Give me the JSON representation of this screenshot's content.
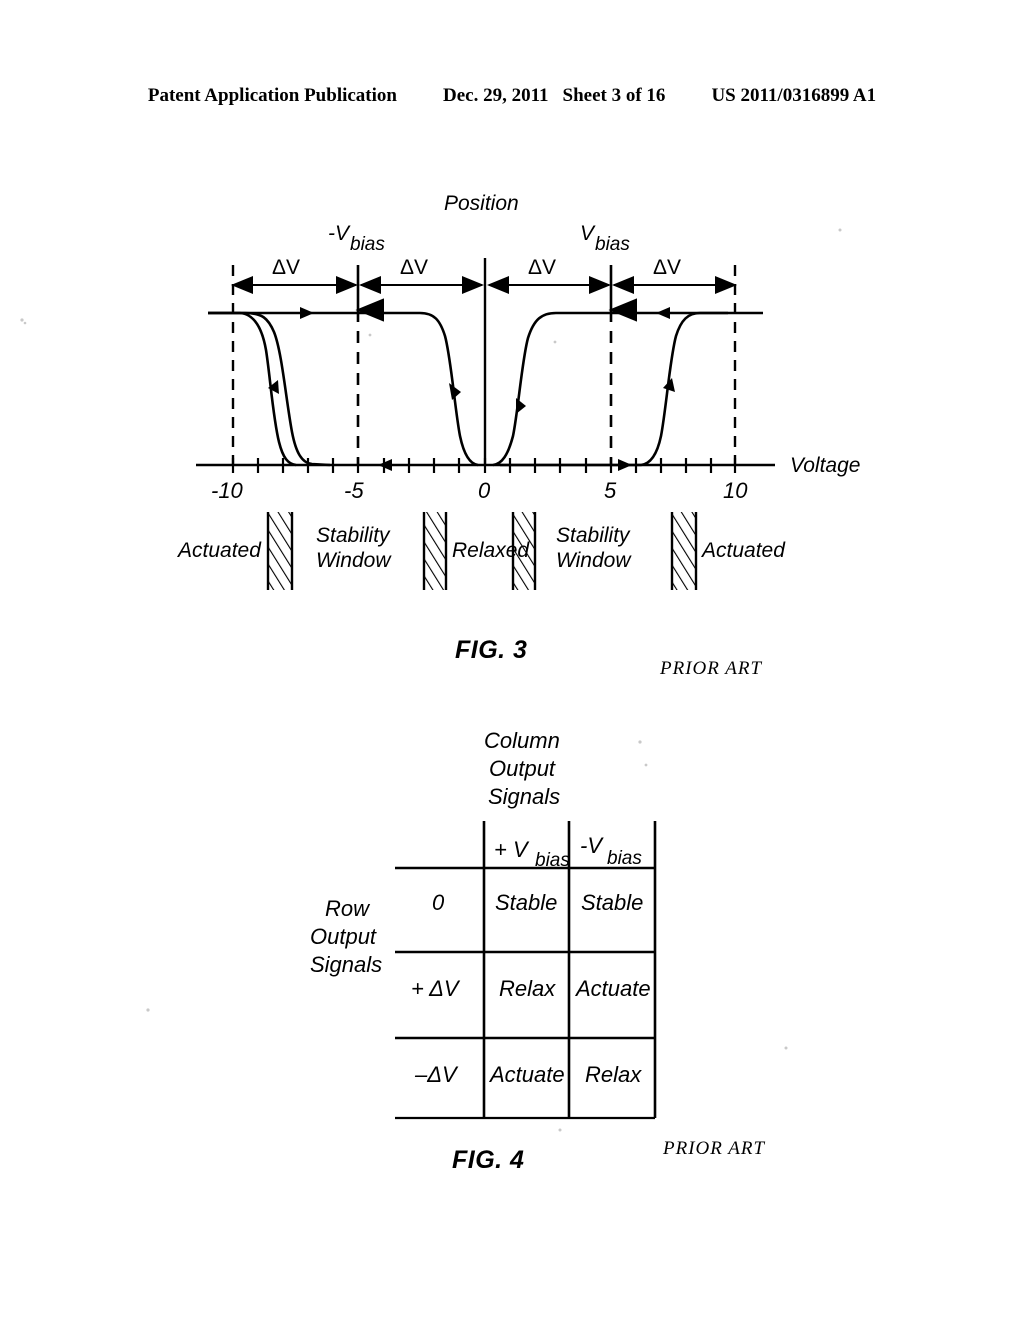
{
  "header": {
    "publication": "Patent Application Publication",
    "date": "Dec. 29, 2011",
    "sheet": "Sheet 3 of 16",
    "patent_number": "US 2011/0316899 A1"
  },
  "figure3": {
    "caption": "FIG. 3",
    "prior_art": "PRIOR ART",
    "y_axis_label": "Position",
    "x_axis_label": "Voltage",
    "bias_left_label": "-V",
    "bias_left_sub": "bias",
    "bias_right_label": "V",
    "bias_right_sub": "bias",
    "delta_labels": [
      "ΔV",
      "ΔV",
      "ΔV",
      "ΔV"
    ],
    "tick_labels": [
      "-10",
      "-5",
      "0",
      "5",
      "10"
    ],
    "region_labels": [
      "Actuated",
      "Stability Window",
      "Relaxed",
      "Stability Window",
      "Actuated"
    ],
    "region_label_lines": [
      [
        "Actuated"
      ],
      [
        "Stability",
        "Window"
      ],
      [
        "Relaxed"
      ],
      [
        "Stability",
        "Window"
      ],
      [
        "Actuated"
      ]
    ]
  },
  "chart_data": {
    "type": "line",
    "title": "",
    "xlabel": "Voltage",
    "ylabel": "Position",
    "xlim": [
      -11.5,
      11.5
    ],
    "ylim": [
      0,
      1
    ],
    "xticks": [
      -10,
      -9,
      -8,
      -7,
      -6,
      -5,
      -4,
      -3,
      -2,
      -1,
      0,
      1,
      2,
      3,
      4,
      5,
      6,
      7,
      8,
      9,
      10
    ],
    "xtick_labels": {
      "-10": "-10",
      "-5": "-5",
      "0": "0",
      "5": "5",
      "10": "10"
    },
    "grid": false,
    "legend": "none",
    "annotations": [
      {
        "text": "-Vbias",
        "x": -5,
        "type": "bias-marker"
      },
      {
        "text": "Vbias",
        "x": 5,
        "type": "bias-marker"
      },
      {
        "text": "ΔV",
        "from": -10,
        "to": -5,
        "type": "span-arrow"
      },
      {
        "text": "ΔV",
        "from": -5,
        "to": 0,
        "type": "span-arrow"
      },
      {
        "text": "ΔV",
        "from": 0,
        "to": 5,
        "type": "span-arrow"
      },
      {
        "text": "ΔV",
        "from": 5,
        "to": 10,
        "type": "span-arrow"
      }
    ],
    "dashed_verticals": [
      -10,
      -5,
      5,
      10
    ],
    "series": [
      {
        "name": "left-upper-branch",
        "comment": "actuated plateau from -10 to about -3 then falls to relaxed near -1",
        "direction": "rightward",
        "points": [
          [
            -11.3,
            1.0
          ],
          [
            -8.0,
            1.0
          ],
          [
            -4.0,
            1.0
          ],
          [
            -2.5,
            0.95
          ],
          [
            -2.0,
            0.6
          ],
          [
            -1.5,
            0.15
          ],
          [
            -1.0,
            0.0
          ],
          [
            -0.3,
            0.0
          ]
        ]
      },
      {
        "name": "left-lower-branch",
        "comment": "relaxed at -7 rising to actuated near -9",
        "direction": "leftward",
        "points": [
          [
            -0.3,
            0.0
          ],
          [
            -7.0,
            0.0
          ],
          [
            -7.6,
            0.12
          ],
          [
            -8.2,
            0.6
          ],
          [
            -8.8,
            0.95
          ],
          [
            -9.5,
            1.0
          ],
          [
            -11.3,
            1.0
          ]
        ]
      },
      {
        "name": "right-lower-branch",
        "comment": "relaxed near 1 rising to actuated plateau near 3",
        "direction": "rightward",
        "points": [
          [
            0.3,
            0.0
          ],
          [
            1.0,
            0.0
          ],
          [
            1.5,
            0.2
          ],
          [
            2.2,
            0.7
          ],
          [
            3.0,
            0.95
          ],
          [
            4.0,
            1.0
          ],
          [
            11.3,
            1.0
          ]
        ]
      },
      {
        "name": "right-upper-branch",
        "comment": "actuated plateau falling back to relaxed near 7-9",
        "direction": "leftward",
        "points": [
          [
            11.3,
            1.0
          ],
          [
            9.5,
            1.0
          ],
          [
            8.8,
            0.9
          ],
          [
            8.2,
            0.55
          ],
          [
            7.5,
            0.12
          ],
          [
            7.0,
            0.0
          ],
          [
            0.3,
            0.0
          ]
        ]
      }
    ],
    "regions": [
      {
        "label": "Actuated",
        "center_x": -9.5
      },
      {
        "label": "Stability Window",
        "center_x": -5.2
      },
      {
        "label": "Relaxed",
        "center_x": -0.2
      },
      {
        "label": "Stability Window",
        "center_x": 4.8
      },
      {
        "label": "Actuated",
        "center_x": 9.6
      }
    ]
  },
  "figure4": {
    "caption": "FIG. 4",
    "prior_art": "PRIOR ART",
    "column_header_lines": [
      "Column",
      "Output",
      "Signals"
    ],
    "row_header_lines": [
      "Row",
      "Output",
      "Signals"
    ],
    "columns": [
      {
        "prefix": "+ V",
        "sub": "bias"
      },
      {
        "prefix": "-V",
        "sub": "bias"
      }
    ],
    "rows": [
      {
        "label": "0",
        "cells": [
          "Stable",
          "Stable"
        ]
      },
      {
        "label": "+ ΔV",
        "cells": [
          "Relax",
          "Actuate"
        ]
      },
      {
        "label": "–ΔV",
        "cells": [
          "Actuate",
          "Relax"
        ]
      }
    ]
  }
}
